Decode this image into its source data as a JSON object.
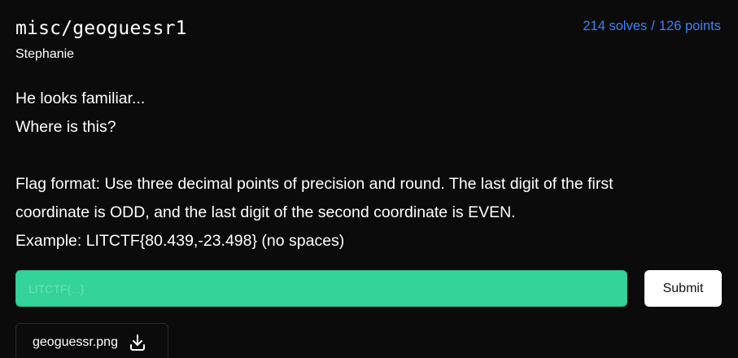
{
  "challenge": {
    "title": "misc/geoguessr1",
    "author": "Stephanie",
    "solves": "214 solves",
    "separator": "/",
    "points": "126 points"
  },
  "description": {
    "line1": "He looks familiar...",
    "line2": "Where is this?",
    "line3": "Flag format: Use three decimal points of precision and round. The last digit of the first",
    "line4": "coordinate is ODD, and the last digit of the second coordinate is EVEN.",
    "line5": "Example: LITCTF{80.439,-23.498} (no spaces)"
  },
  "flag_input": {
    "placeholder": "LITCTF{...}",
    "value": ""
  },
  "submit": {
    "label": "Submit"
  },
  "attachment": {
    "filename": "geoguessr.png",
    "icon": "download-icon"
  },
  "colors": {
    "background": "#0b0b0b",
    "accent_blue": "#3b82f6",
    "input_green": "#34d399"
  }
}
